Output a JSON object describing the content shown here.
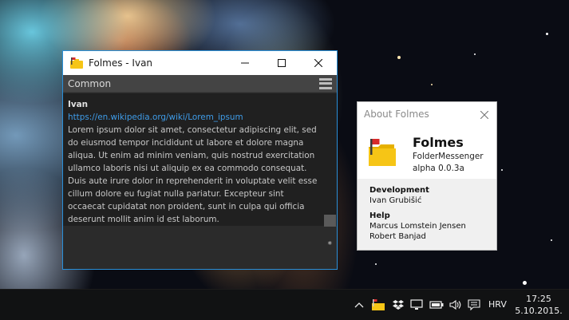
{
  "main_window": {
    "title": "Folmes - Ivan",
    "channel_label": "Common",
    "message": {
      "author": "Ivan",
      "link": "https://en.wikipedia.org/wiki/Lorem_ipsum",
      "text": "Lorem ipsum dolor sit amet, consectetur adipiscing elit, sed do eiusmod tempor incididunt ut labore et dolore magna aliqua. Ut enim ad minim veniam, quis nostrud exercitation ullamco laboris nisi ut aliquip ex ea commodo consequat. Duis aute irure dolor in reprehenderit in voluptate velit esse cillum dolore eu fugiat nulla pariatur. Excepteur sint occaecat cupidatat non proident, sunt in culpa qui officia deserunt mollit anim id est laborum."
    },
    "input_marker": "*"
  },
  "about_window": {
    "title": "About Folmes",
    "app_name": "Folmes",
    "app_subtitle": "FolderMessenger",
    "version": "alpha 0.0.3a",
    "development_heading": "Development",
    "developer": "Ivan Grubišić",
    "help_heading": "Help",
    "helpers": [
      "Marcus Lomstein Jensen",
      "Robert Banjad"
    ]
  },
  "taskbar": {
    "language": "HRV",
    "time": "17:25",
    "date": "5.10.2015.",
    "tray_icons": [
      "chevron-up-icon",
      "folmes-tray-icon",
      "dropbox-icon",
      "network-icon",
      "battery-icon",
      "volume-icon",
      "notifications-icon"
    ]
  },
  "colors": {
    "accent_border": "#2a8fd8",
    "link": "#3f9ce8",
    "folder_yellow": "#f6c516",
    "flag_red": "#d82b2b"
  }
}
